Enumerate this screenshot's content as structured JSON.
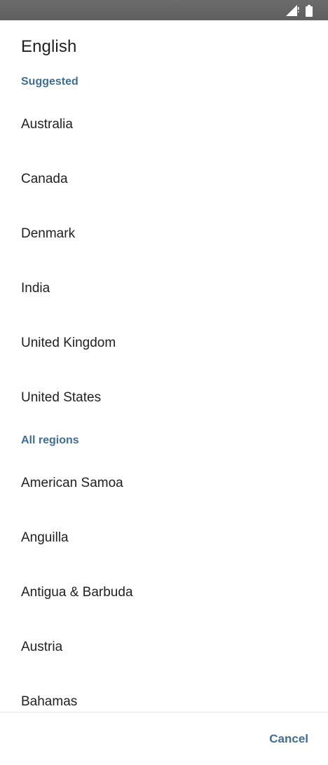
{
  "dialog": {
    "title": "English",
    "suggested_header": "Suggested",
    "suggested": [
      "Australia",
      "Canada",
      "Denmark",
      "India",
      "United Kingdom",
      "United States"
    ],
    "all_header": "All regions",
    "all": [
      "American Samoa",
      "Anguilla",
      "Antigua & Barbuda",
      "Austria",
      "Bahamas"
    ],
    "cancel_label": "Cancel"
  },
  "status_bar": {
    "icons": [
      "signal-icon",
      "battery-icon"
    ]
  },
  "colors": {
    "accent": "#3f6d96",
    "status_bar": "#646464",
    "text": "#202124"
  }
}
